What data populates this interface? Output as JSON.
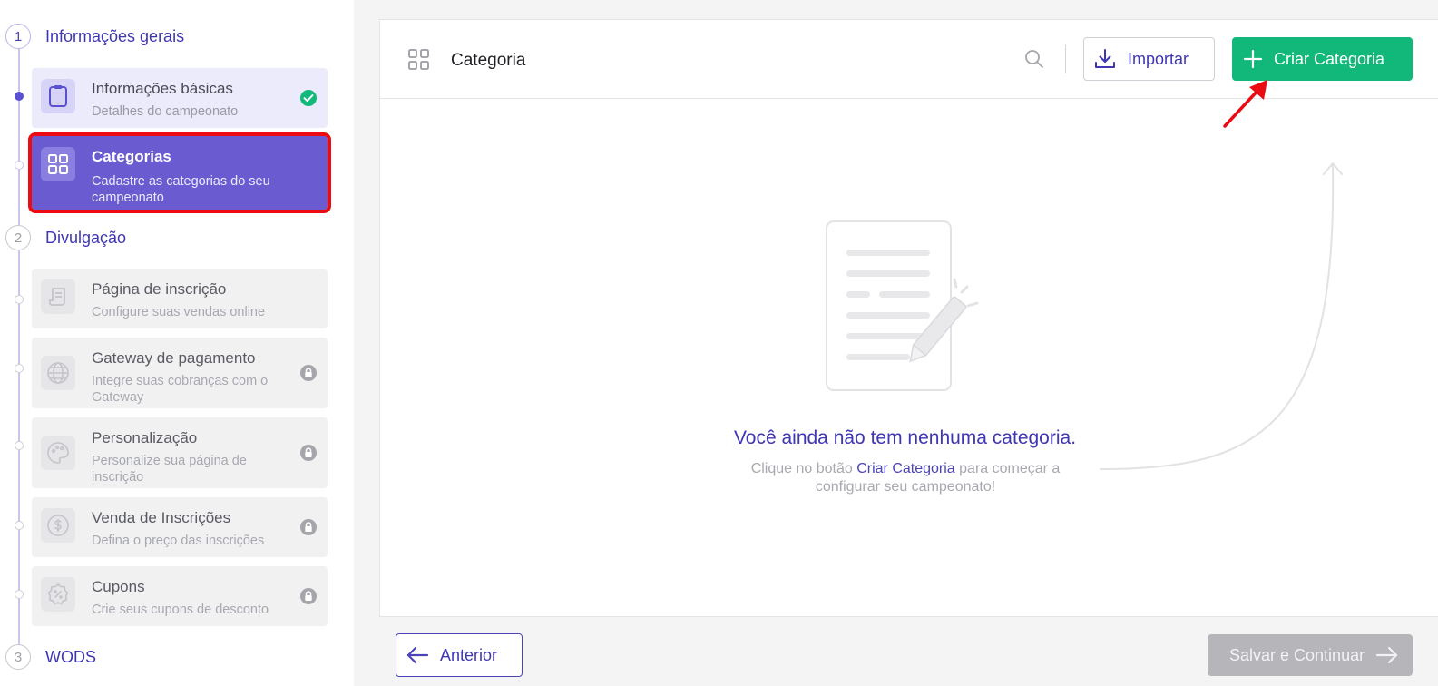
{
  "sidebar": {
    "sections": [
      {
        "number": "1",
        "title": "Informações gerais"
      },
      {
        "number": "2",
        "title": "Divulgação"
      },
      {
        "number": "3",
        "title": "WODS"
      }
    ],
    "steps": [
      {
        "title": "Informações básicas",
        "desc": "Detalhes do campeonato",
        "icon": "clipboard-icon",
        "status": "completed"
      },
      {
        "title": "Categorias",
        "desc": "Cadastre as categorias do seu campeonato",
        "icon": "grid-icon",
        "status": "active"
      },
      {
        "title": "Página de inscrição",
        "desc": "Configure suas vendas online",
        "icon": "receipt-icon",
        "status": "available"
      },
      {
        "title": "Gateway de pagamento",
        "desc": "Integre suas cobranças com o Gateway",
        "icon": "globe-icon",
        "status": "locked"
      },
      {
        "title": "Personalização",
        "desc": "Personalize sua página de inscrição",
        "icon": "palette-icon",
        "status": "locked"
      },
      {
        "title": "Venda de Inscrições",
        "desc": "Defina o preço das inscrições",
        "icon": "dollar-icon",
        "status": "locked"
      },
      {
        "title": "Cupons",
        "desc": "Crie seus cupons de desconto",
        "icon": "percent-badge-icon",
        "status": "locked"
      }
    ]
  },
  "header": {
    "title": "Categoria",
    "import_label": "Importar",
    "create_label": "Criar Categoria"
  },
  "empty_state": {
    "title": "Você ainda não tem nenhuma categoria.",
    "desc_before": "Clique no botão ",
    "desc_link": "Criar Categoria",
    "desc_after": " para começar a configurar seu campeonato!"
  },
  "footer": {
    "prev_label": "Anterior",
    "next_label": "Salvar e Continuar"
  },
  "colors": {
    "primary": "#3f36b3",
    "active_step": "#6a5bd0",
    "success": "#12b77a",
    "highlight": "#ea0c12",
    "disabled": "#b5b5ba"
  }
}
